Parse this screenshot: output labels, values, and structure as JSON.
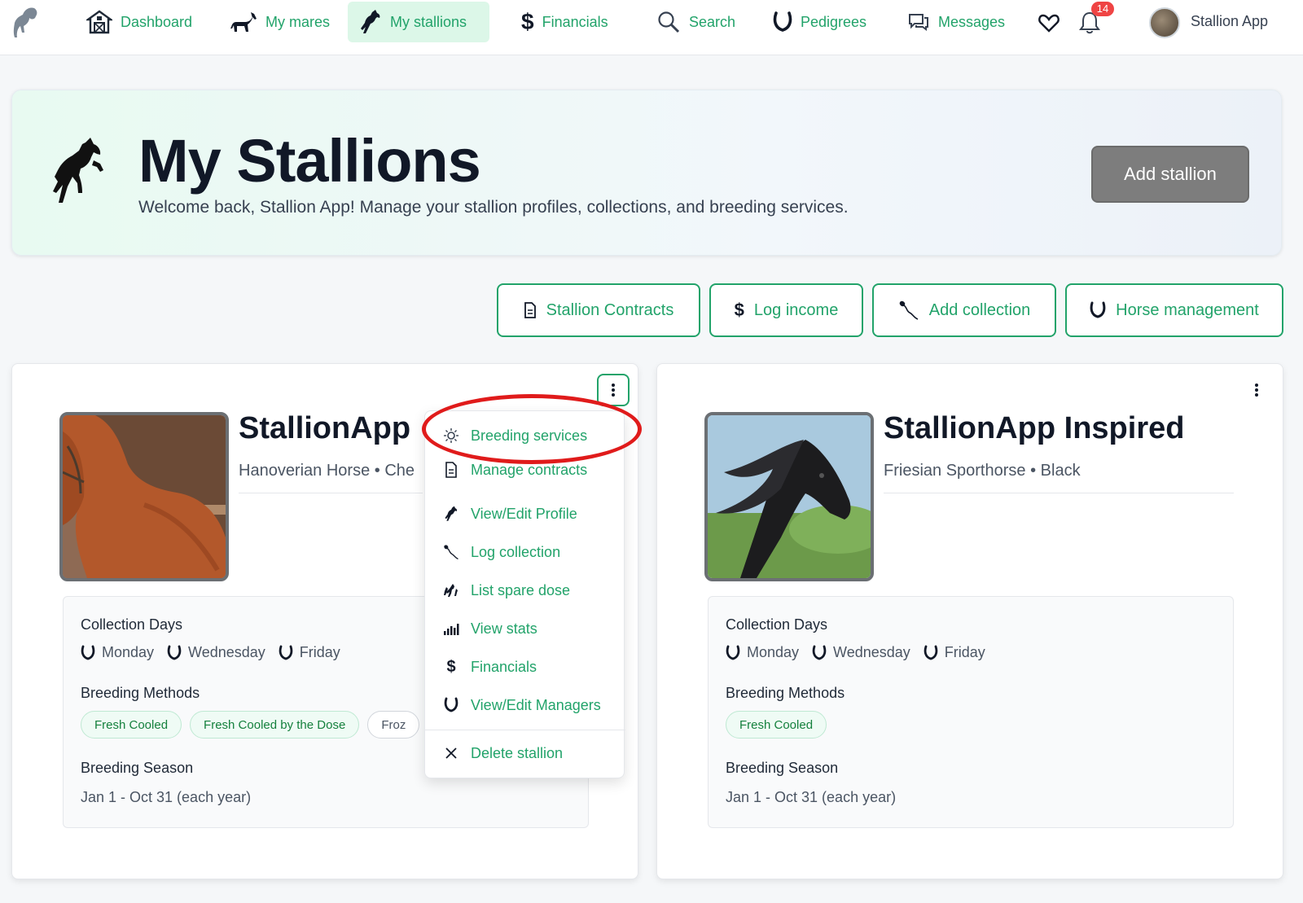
{
  "nav": {
    "items": [
      {
        "label": "Dashboard",
        "icon": "barn-icon"
      },
      {
        "label": "My mares",
        "icon": "mare-icon"
      },
      {
        "label": "My stallions",
        "icon": "stallion-icon",
        "active": true
      },
      {
        "label": "Financials",
        "icon": "dollar-icon"
      },
      {
        "label": "Search",
        "icon": "magnifier-icon"
      },
      {
        "label": "Pedigrees",
        "icon": "horseshoe-icon"
      },
      {
        "label": "Messages",
        "icon": "chat-bubbles-icon"
      }
    ],
    "notification_count": "14",
    "user_name": "Stallion App"
  },
  "hero": {
    "title": "My Stallions",
    "subtitle": "Welcome back, Stallion App! Manage your stallion profiles, collections, and breeding services.",
    "add_button": "Add stallion"
  },
  "actions": [
    {
      "label": "Stallion Contracts",
      "icon": "document-icon"
    },
    {
      "label": "Log income",
      "icon": "dollar-icon"
    },
    {
      "label": "Add collection",
      "icon": "sperm-icon"
    },
    {
      "label": "Horse management",
      "icon": "horseshoe-icon"
    }
  ],
  "stallions": [
    {
      "name": "StallionApp",
      "breed": "Hanoverian Horse",
      "color": "Che",
      "collection_days_label": "Collection Days",
      "days": [
        "Monday",
        "Wednesday",
        "Friday"
      ],
      "methods_label": "Breeding Methods",
      "methods": [
        "Fresh Cooled",
        "Fresh Cooled by the Dose",
        "Froz"
      ],
      "season_label": "Breeding Season",
      "season": "Jan 1 - Oct 31 (each year)"
    },
    {
      "name": "StallionApp Inspired",
      "breed": "Friesian Sporthorse",
      "color": "Black",
      "collection_days_label": "Collection Days",
      "days": [
        "Monday",
        "Wednesday",
        "Friday"
      ],
      "methods_label": "Breeding Methods",
      "methods": [
        "Fresh Cooled"
      ],
      "season_label": "Breeding Season",
      "season": "Jan 1 - Oct 31 (each year)"
    }
  ],
  "menu": {
    "items": [
      {
        "label": "Breeding services",
        "icon": "sun-gear-icon"
      },
      {
        "label": "Manage contracts",
        "icon": "document-icon"
      },
      {
        "label": "View/Edit Profile",
        "icon": "stallion-icon"
      },
      {
        "label": "Log collection",
        "icon": "sperm-icon"
      },
      {
        "label": "List spare dose",
        "icon": "horses-icon"
      },
      {
        "label": "View stats",
        "icon": "bar-chart-icon"
      },
      {
        "label": "Financials",
        "icon": "dollar-icon"
      },
      {
        "label": "View/Edit Managers",
        "icon": "horseshoe-icon"
      },
      {
        "label": "Delete stallion",
        "icon": "close-icon"
      }
    ]
  },
  "colors": {
    "accent": "#22a36a",
    "highlight": "#e01b1b",
    "add_button": "#7d7d7d"
  }
}
